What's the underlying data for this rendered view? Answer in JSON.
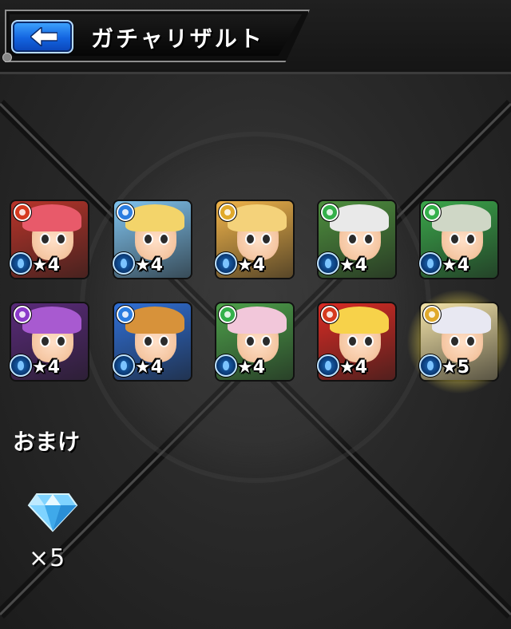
{
  "header": {
    "title": "ガチャリザルト"
  },
  "results": [
    {
      "rarity": "★4",
      "element": "fire",
      "element_color": "#d63a1f",
      "bg": "#b8342a",
      "hair": "#e85a6a"
    },
    {
      "rarity": "★4",
      "element": "water",
      "element_color": "#2b7de0",
      "bg": "#7fc3ef",
      "hair": "#f3d46a"
    },
    {
      "rarity": "★4",
      "element": "light",
      "element_color": "#e0a92b",
      "bg": "#f1b44a",
      "hair": "#f4d27a"
    },
    {
      "rarity": "★4",
      "element": "wood",
      "element_color": "#34b04a",
      "bg": "#4e8f3e",
      "hair": "#e9e9e9"
    },
    {
      "rarity": "★4",
      "element": "wood",
      "element_color": "#34b04a",
      "bg": "#3aa64a",
      "hair": "#cfd7c6"
    },
    {
      "rarity": "★4",
      "element": "dark",
      "element_color": "#8b3ac9",
      "bg": "#5a2a7a",
      "hair": "#a85ad0"
    },
    {
      "rarity": "★4",
      "element": "water",
      "element_color": "#2b7de0",
      "bg": "#2f6fd6",
      "hair": "#d7923a"
    },
    {
      "rarity": "★4",
      "element": "wood",
      "element_color": "#34b04a",
      "bg": "#4da04a",
      "hair": "#f2c7da"
    },
    {
      "rarity": "★4",
      "element": "fire",
      "element_color": "#d63a1f",
      "bg": "#d92b24",
      "hair": "#f7d24a"
    },
    {
      "rarity": "★5",
      "element": "light",
      "element_color": "#e0a92b",
      "bg": "#f3e3a8",
      "hair": "#e8e8f2"
    }
  ],
  "bonus": {
    "title": "おまけ",
    "count": "×5",
    "item_icon": "orb-gem-icon"
  }
}
